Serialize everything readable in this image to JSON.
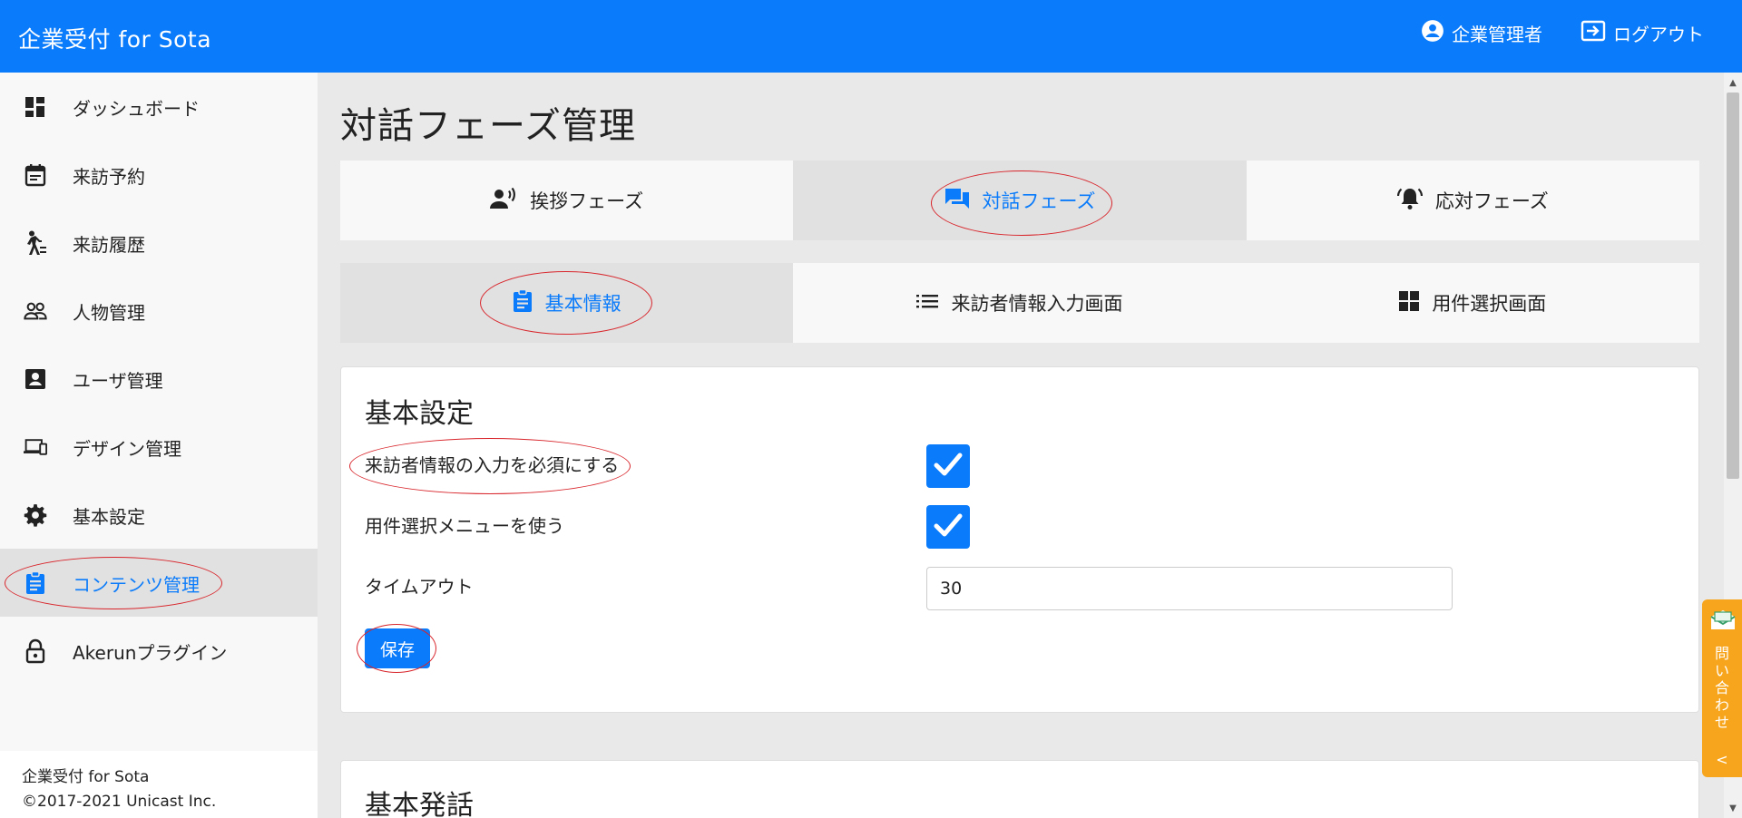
{
  "header": {
    "brand": "企業受付 for Sota",
    "user_label": "企業管理者",
    "logout_label": "ログアウト",
    "bg_color": "#0a7bfa"
  },
  "sidebar": {
    "items": [
      {
        "label": "ダッシュボード",
        "icon": "dashboard-icon"
      },
      {
        "label": "来訪予約",
        "icon": "calendar-icon"
      },
      {
        "label": "来訪履歴",
        "icon": "walking-person-icon"
      },
      {
        "label": "人物管理",
        "icon": "people-icon"
      },
      {
        "label": "ユーザ管理",
        "icon": "user-card-icon"
      },
      {
        "label": "デザイン管理",
        "icon": "devices-icon"
      },
      {
        "label": "基本設定",
        "icon": "gear-icon"
      },
      {
        "label": "コンテンツ管理",
        "icon": "clipboard-icon",
        "active": true
      },
      {
        "label": "Akerunプラグイン",
        "icon": "lock-icon"
      }
    ],
    "footer_line1": "企業受付 for Sota",
    "footer_line2": "©2017-2021 Unicast Inc."
  },
  "main": {
    "page_title": "対話フェーズ管理",
    "phase_tabs": [
      {
        "label": "挨拶フェーズ",
        "icon": "voice-person-icon"
      },
      {
        "label": "対話フェーズ",
        "icon": "chat-icon",
        "active": true
      },
      {
        "label": "応対フェーズ",
        "icon": "bell-icon"
      }
    ],
    "sub_tabs": [
      {
        "label": "基本情報",
        "icon": "clipboard-icon",
        "active": true
      },
      {
        "label": "来訪者情報入力画面",
        "icon": "list-icon"
      },
      {
        "label": "用件選択画面",
        "icon": "grid-icon"
      }
    ],
    "basic_settings": {
      "title": "基本設定",
      "require_visitor_info_label": "来訪者情報の入力を必須にする",
      "require_visitor_info_checked": true,
      "use_purpose_menu_label": "用件選択メニューを使う",
      "use_purpose_menu_checked": true,
      "timeout_label": "タイムアウト",
      "timeout_value": "30",
      "save_label": "保存"
    },
    "basic_speech": {
      "title": "基本発話"
    }
  },
  "contact_tab": {
    "chars": [
      "問",
      "い",
      "合",
      "わ",
      "せ"
    ],
    "chevron": "<",
    "color": "#f7a51c"
  },
  "accent_color": "#0a7bfa",
  "annotation_color": "#d8252b"
}
